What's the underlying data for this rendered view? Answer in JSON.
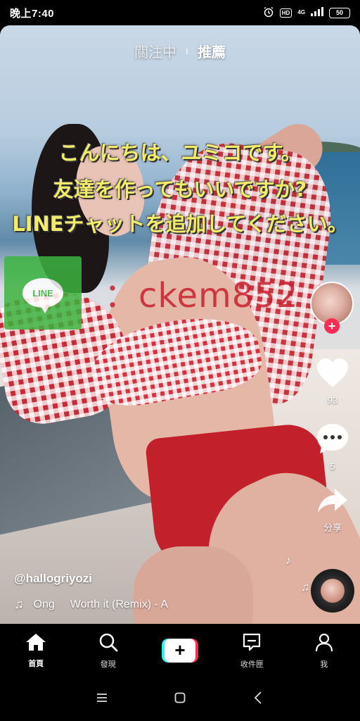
{
  "status_bar": {
    "time": "晚上7:40",
    "hd": "HD",
    "network": "4G",
    "battery": "50"
  },
  "top_tabs": {
    "following": "關注中",
    "for_you": "推薦"
  },
  "overlay": {
    "line1": "こんにちは、ユミコです。",
    "line2": "友達を作ってもいいですか?",
    "line3": "LINEチャットを追加してください。",
    "line_logo": "LINE",
    "line_id": "：ckem852"
  },
  "actions": {
    "likes": "93",
    "comments": "5",
    "share": "分享"
  },
  "caption": {
    "username": "@hallogriyozi",
    "music_artist": "Ong",
    "music_title": "Worth it (Remix) - A"
  },
  "bottom_nav": {
    "home": "首頁",
    "discover": "發現",
    "create": "+",
    "inbox": "收件匣",
    "me": "我"
  },
  "colors": {
    "accent": "#fe2c55",
    "cyan": "#25f4ee",
    "overlay_text": "#f3ec6a",
    "line_green": "#3cb43f"
  }
}
